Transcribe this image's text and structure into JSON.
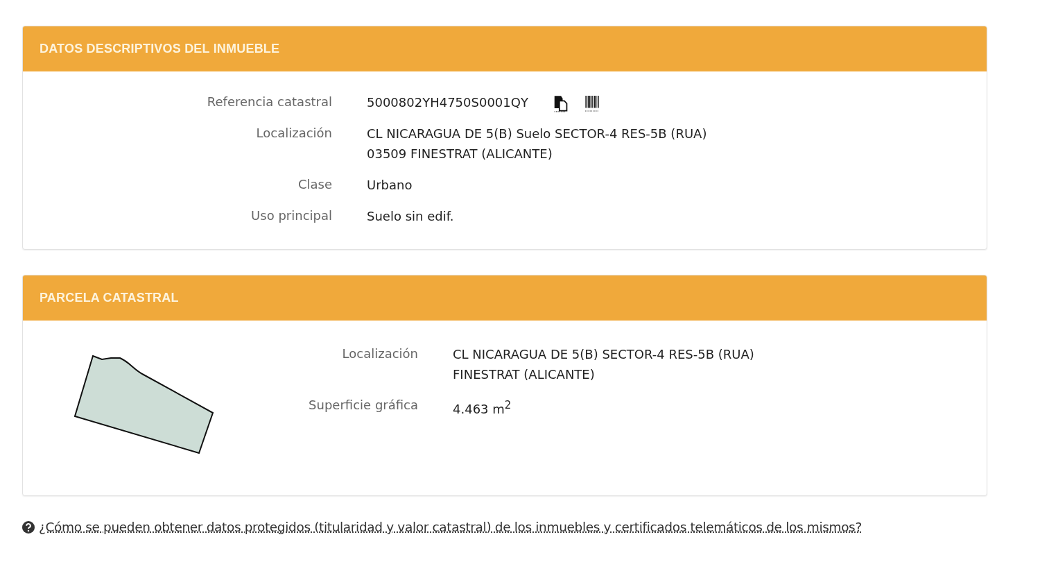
{
  "panels": [
    {
      "title": "DATOS DESCRIPTIVOS DEL INMUEBLE",
      "kind": "fields",
      "rows": [
        {
          "label": "Referencia catastral",
          "lines": [
            "5000802YH4750S0001QY"
          ],
          "kind": "reference"
        },
        {
          "label": "Localización",
          "lines": [
            "CL NICARAGUA DE 5(B) Suelo SECTOR-4 RES-5B (RUA)",
            "03509 FINESTRAT (ALICANTE)"
          ],
          "kind": "text"
        },
        {
          "label": "Clase",
          "lines": [
            "Urbano"
          ],
          "kind": "text"
        },
        {
          "label": "Uso principal",
          "lines": [
            "Suelo sin edif."
          ],
          "kind": "text"
        }
      ]
    },
    {
      "title": "PARCELA CATASTRAL",
      "kind": "parcel",
      "rows": [
        {
          "label": "Localización",
          "lines": [
            "CL NICARAGUA DE 5(B) SECTOR-4 RES-5B (RUA)",
            "FINESTRAT (ALICANTE)"
          ],
          "kind": "text"
        },
        {
          "label": "Superficie gráfica",
          "lines": [
            "4.463 m$^{2}$"
          ],
          "kind": "text"
        }
      ]
    }
  ],
  "help_link": "¿Cómo se pueden obtener datos protegidos (titularidad y valor catastral) de los inmuebles y certificados telemáticos de los mismos?"
}
